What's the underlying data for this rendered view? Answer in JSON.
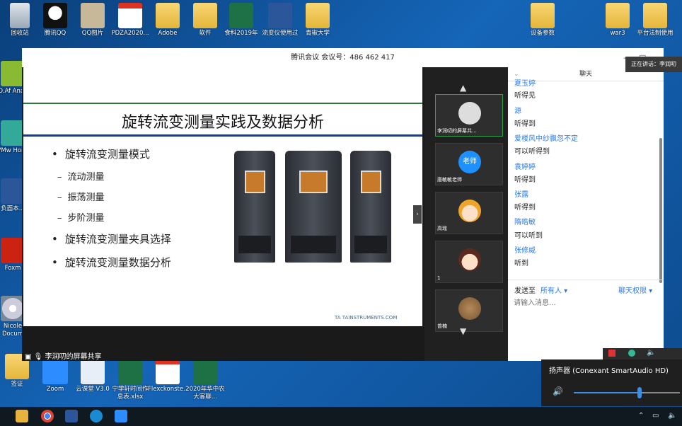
{
  "desktop": {
    "icons_top": [
      {
        "label": "回收站",
        "kind": "bin"
      },
      {
        "label": "腾讯QQ",
        "kind": "qq"
      },
      {
        "label": "QQ图片",
        "kind": "folder"
      },
      {
        "label": "PDZA2020...",
        "kind": "pdf"
      },
      {
        "label": "Adobe",
        "kind": "folder"
      },
      {
        "label": "软件",
        "kind": "folder"
      },
      {
        "label": "食科2019年",
        "kind": "xls"
      },
      {
        "label": "流变仪使用过",
        "kind": "doc"
      },
      {
        "label": "青椒大学",
        "kind": "folder"
      },
      {
        "label": "设备参数",
        "kind": "folder"
      },
      {
        "label": "war3",
        "kind": "folder"
      },
      {
        "label": "平台法制使用",
        "kind": "folder"
      }
    ],
    "icons_left": [
      {
        "label": "MO.Af Analys",
        "kind": "app"
      },
      {
        "label": "VMw Horiz",
        "kind": "app"
      },
      {
        "label": "负面本...",
        "kind": "doc"
      },
      {
        "label": "Foxm",
        "kind": "red"
      },
      {
        "label": "Nicole Docum",
        "kind": "cd"
      },
      {
        "label": "签证",
        "kind": "folder"
      }
    ],
    "icons_bottom": [
      {
        "label": "Zoom",
        "kind": "zoom"
      },
      {
        "label": "云课堂 V3.0",
        "kind": "app"
      },
      {
        "label": "宁学轩时间作息表.xlsx",
        "kind": "xls"
      },
      {
        "label": "Flexckonste...",
        "kind": "pdf"
      },
      {
        "label": "2020年华中农大客聊...",
        "kind": "xls"
      }
    ]
  },
  "meeting": {
    "title": "腾讯会议 会议号：486 462 417",
    "share_label": "李润叨的屏幕共享",
    "speaking_tooltip": "正在讲话：李润叨"
  },
  "slide": {
    "title": "旋转流变测量实践及数据分析",
    "bullets": [
      {
        "text": "旋转流变测量模式",
        "sub": [
          "流动测量",
          "振荡测量",
          "步阶测量"
        ]
      },
      {
        "text": "旋转流变测量夹具选择",
        "sub": []
      },
      {
        "text": "旋转流变测量数据分析",
        "sub": []
      }
    ],
    "logo_text": "TA  TAINSTRUMENTS.COM"
  },
  "participants": [
    {
      "name": "李润叨的屏幕共...",
      "avatar": "share"
    },
    {
      "name": "唐敏敏老师",
      "avatar": "老师"
    },
    {
      "name": "高瑶",
      "avatar": "girl"
    },
    {
      "name": "1",
      "avatar": "girl2"
    },
    {
      "name": "曾楠",
      "avatar": "egg"
    }
  ],
  "chat": {
    "header": "聊天",
    "messages": [
      {
        "name": "夏玉婷",
        "text": "听得见"
      },
      {
        "name": "源",
        "text": "听得到"
      },
      {
        "name": "爱楼风中纱飘忽不定",
        "text": "可以听得到"
      },
      {
        "name": "袁婷婷",
        "text": "听得到"
      },
      {
        "name": "张露",
        "text": "听得到"
      },
      {
        "name": "隋皓敏",
        "text": "可以听到"
      },
      {
        "name": "张修威",
        "text": "听到"
      }
    ],
    "send_to_label": "发送至",
    "send_to_value": "所有人",
    "permission_label": "聊天权限",
    "input_placeholder": "请输入消息..."
  },
  "volume": {
    "device": "扬声器 (Conexant SmartAudio HD)",
    "level": 0.62
  },
  "colors": {
    "accent": "#2c7be5",
    "desktop": "#1565b8",
    "active_border": "#2aa34a"
  }
}
